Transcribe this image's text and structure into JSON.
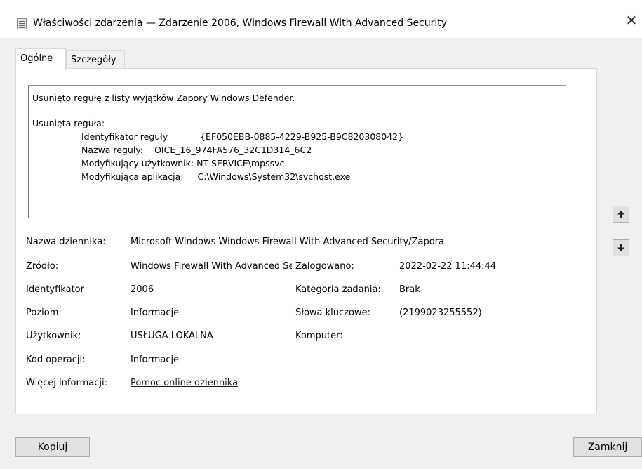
{
  "window": {
    "title": "Właściwości zdarzenia — Zdarzenie 2006, Windows Firewall With Advanced Security",
    "close_glyph": "✕"
  },
  "tabs": [
    {
      "label": "Ogólne",
      "active": true
    },
    {
      "label": "Szczegóły",
      "active": false
    }
  ],
  "description": {
    "line1": "Usunięto regułę z listy wyjątków Zapory Windows Defender.",
    "line2": "Usunięta reguła:",
    "rule_id_label": "Identyfikator reguły",
    "rule_id_value": "{EF050EBB-0885-4229-B925-B9C820308042}",
    "rule_name_label": "Nazwa reguły:",
    "rule_name_value": "OICE_16_974FA576_32C1D314_6C2",
    "modifying_user_label": "Modyfikujący użytkownik:",
    "modifying_user_value": "NT SERVICE\\mpssvc",
    "modifying_app_label": "Modyfikująca aplikacja:",
    "modifying_app_value": "C:\\Windows\\System32\\svchost.exe"
  },
  "fields": {
    "log_name_label": "Nazwa dziennika:",
    "log_name_value": "Microsoft-Windows-Windows Firewall With Advanced Security/Zapora",
    "source_label": "Źródło:",
    "source_value": "Windows Firewall With Advanced Security",
    "logged_label": "Zalogowano:",
    "logged_value": "2022-02-22 11:44:44",
    "event_id_label": "Identyfikator",
    "event_id_value": "2006",
    "task_category_label": "Kategoria zadania:",
    "task_category_value": "Brak",
    "level_label": "Poziom:",
    "level_value": "Informacje",
    "keywords_label": "Słowa kluczowe:",
    "keywords_value": "(2199023255552)",
    "user_label": "Użytkownik:",
    "user_value": "USŁUGA LOKALNA",
    "computer_label": "Komputer:",
    "computer_value": "",
    "opcode_label": "Kod operacji:",
    "opcode_value": "Informacje",
    "more_info_label": "Więcej informacji:",
    "more_info_link": "Pomoc online dziennika"
  },
  "nav": {
    "up_icon": "arrow-up-icon",
    "down_icon": "arrow-down-icon"
  },
  "buttons": {
    "copy": "Kopiuj",
    "close": "Zamknij"
  }
}
